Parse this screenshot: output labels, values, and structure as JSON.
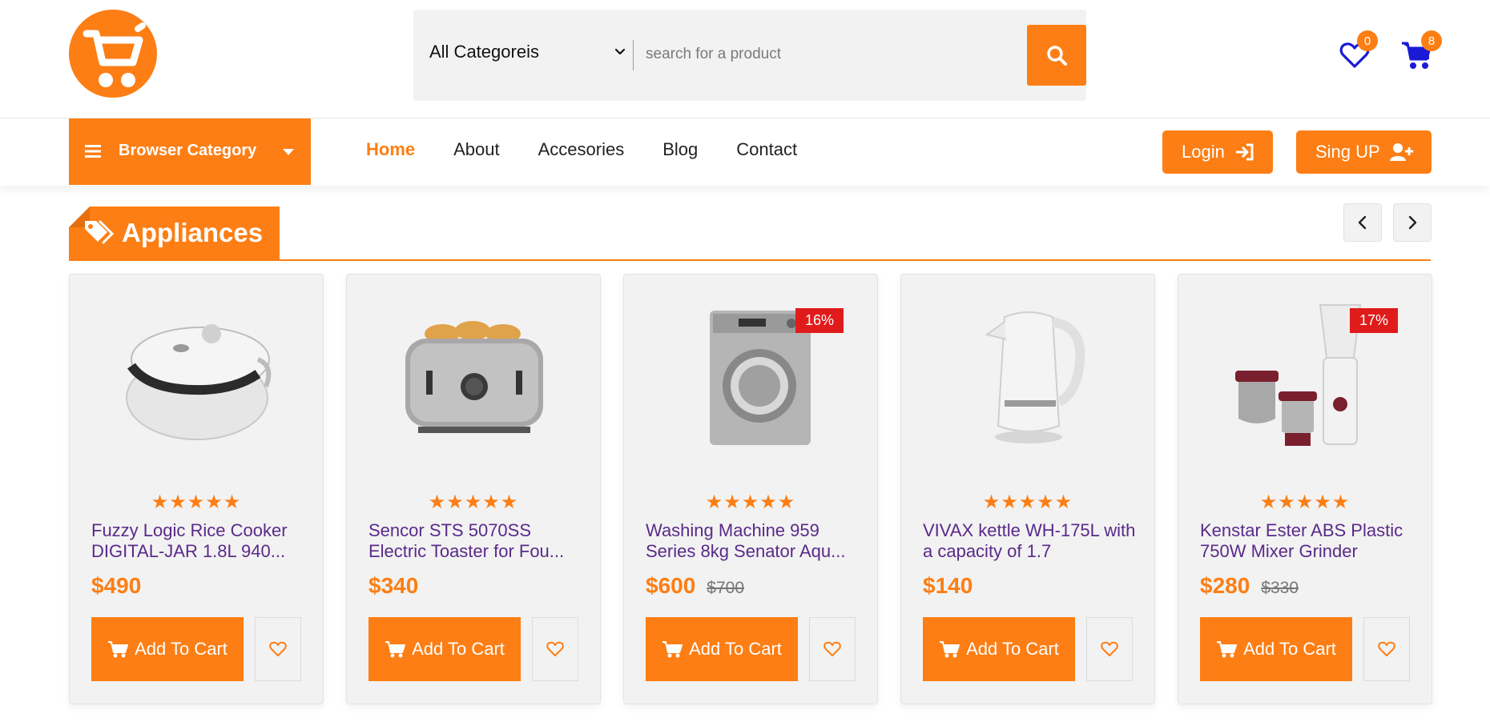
{
  "header": {
    "logo_icon": "shopping-cart-logo",
    "search": {
      "category_selected": "All Categoreis",
      "placeholder": "search for a product",
      "button_icon": "search-icon"
    },
    "wishlist_count": "0",
    "cart_count": "8"
  },
  "nav": {
    "browse_label": "Browser Category",
    "links": [
      "Home",
      "About",
      "Accesories",
      "Blog",
      "Contact"
    ],
    "active": "Home",
    "login_label": "Login",
    "signup_label": "Sing UP"
  },
  "section": {
    "title": "Appliances"
  },
  "products": [
    {
      "name": "Fuzzy Logic Rice Cooker DIGITAL-JAR 1.8L 940...",
      "price": "$490",
      "old_price": "",
      "discount": "",
      "rating": 5,
      "cart_label": "Add To Cart"
    },
    {
      "name": "Sencor STS 5070SS Electric Toaster for Fou...",
      "price": "$340",
      "old_price": "",
      "discount": "",
      "rating": 5,
      "cart_label": "Add To Cart"
    },
    {
      "name": "Washing Machine 959 Series 8kg Senator Aqu...",
      "price": "$600",
      "old_price": "$700",
      "discount": "16%",
      "rating": 5,
      "cart_label": "Add To Cart"
    },
    {
      "name": "VIVAX kettle WH-175L with a capacity of 1.7",
      "price": "$140",
      "old_price": "",
      "discount": "",
      "rating": 5,
      "cart_label": "Add To Cart"
    },
    {
      "name": "Kenstar Ester ABS Plastic 750W Mixer Grinder",
      "price": "$280",
      "old_price": "$330",
      "discount": "17%",
      "rating": 5,
      "cart_label": "Add To Cart"
    }
  ],
  "colors": {
    "accent": "#fd7e14",
    "discount": "#e01b1b",
    "product_name": "#5a2a8a",
    "header_icons": "#1a1ad6"
  }
}
